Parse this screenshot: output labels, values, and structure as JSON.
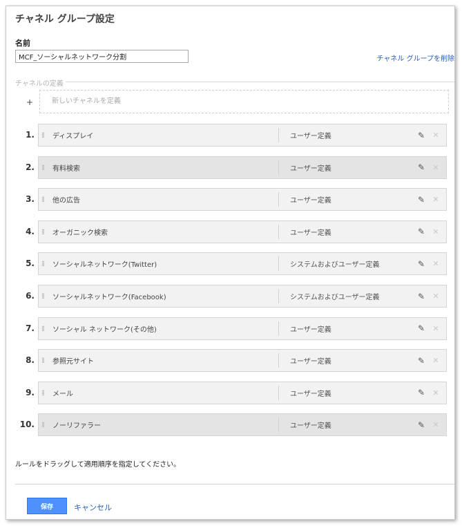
{
  "dialog": {
    "title": "チャネル グループ設定",
    "name_label": "名前",
    "name_value": "MCF_ソーシャルネットワーク分割",
    "delete_link": "チャネル グループを削除",
    "definition_label": "チャネルの定義",
    "add_plus": "+",
    "add_channel": "新しいチャネルを定義",
    "hint": "ルールをドラッグして適用順序を指定してください。",
    "save_label": "保存",
    "cancel_label": "キャンセル"
  },
  "icons": {
    "grip": "drag-handle-icon",
    "edit": "pencil-icon",
    "remove": "close-icon"
  },
  "colors": {
    "link": "#2a5db0",
    "save_button": "#4d90fe",
    "row_bg": "#f2f2f2",
    "row_bg_alt": "#e4e4e4"
  },
  "channels": [
    {
      "num": "1.",
      "name": "ディスプレイ",
      "type": "ユーザー定義"
    },
    {
      "num": "2.",
      "name": "有料検索",
      "type": "ユーザー定義"
    },
    {
      "num": "3.",
      "name": "他の広告",
      "type": "ユーザー定義"
    },
    {
      "num": "4.",
      "name": "オーガニック検索",
      "type": "ユーザー定義"
    },
    {
      "num": "5.",
      "name": "ソーシャルネットワーク(Twitter)",
      "type": "システムおよびユーザー定義"
    },
    {
      "num": "6.",
      "name": "ソーシャルネットワーク(Facebook)",
      "type": "システムおよびユーザー定義"
    },
    {
      "num": "7.",
      "name": "ソーシャル ネットワーク(その他)",
      "type": "ユーザー定義"
    },
    {
      "num": "8.",
      "name": "参照元サイト",
      "type": "ユーザー定義"
    },
    {
      "num": "9.",
      "name": "メール",
      "type": "ユーザー定義"
    },
    {
      "num": "10.",
      "name": "ノーリファラー",
      "type": "ユーザー定義"
    }
  ]
}
